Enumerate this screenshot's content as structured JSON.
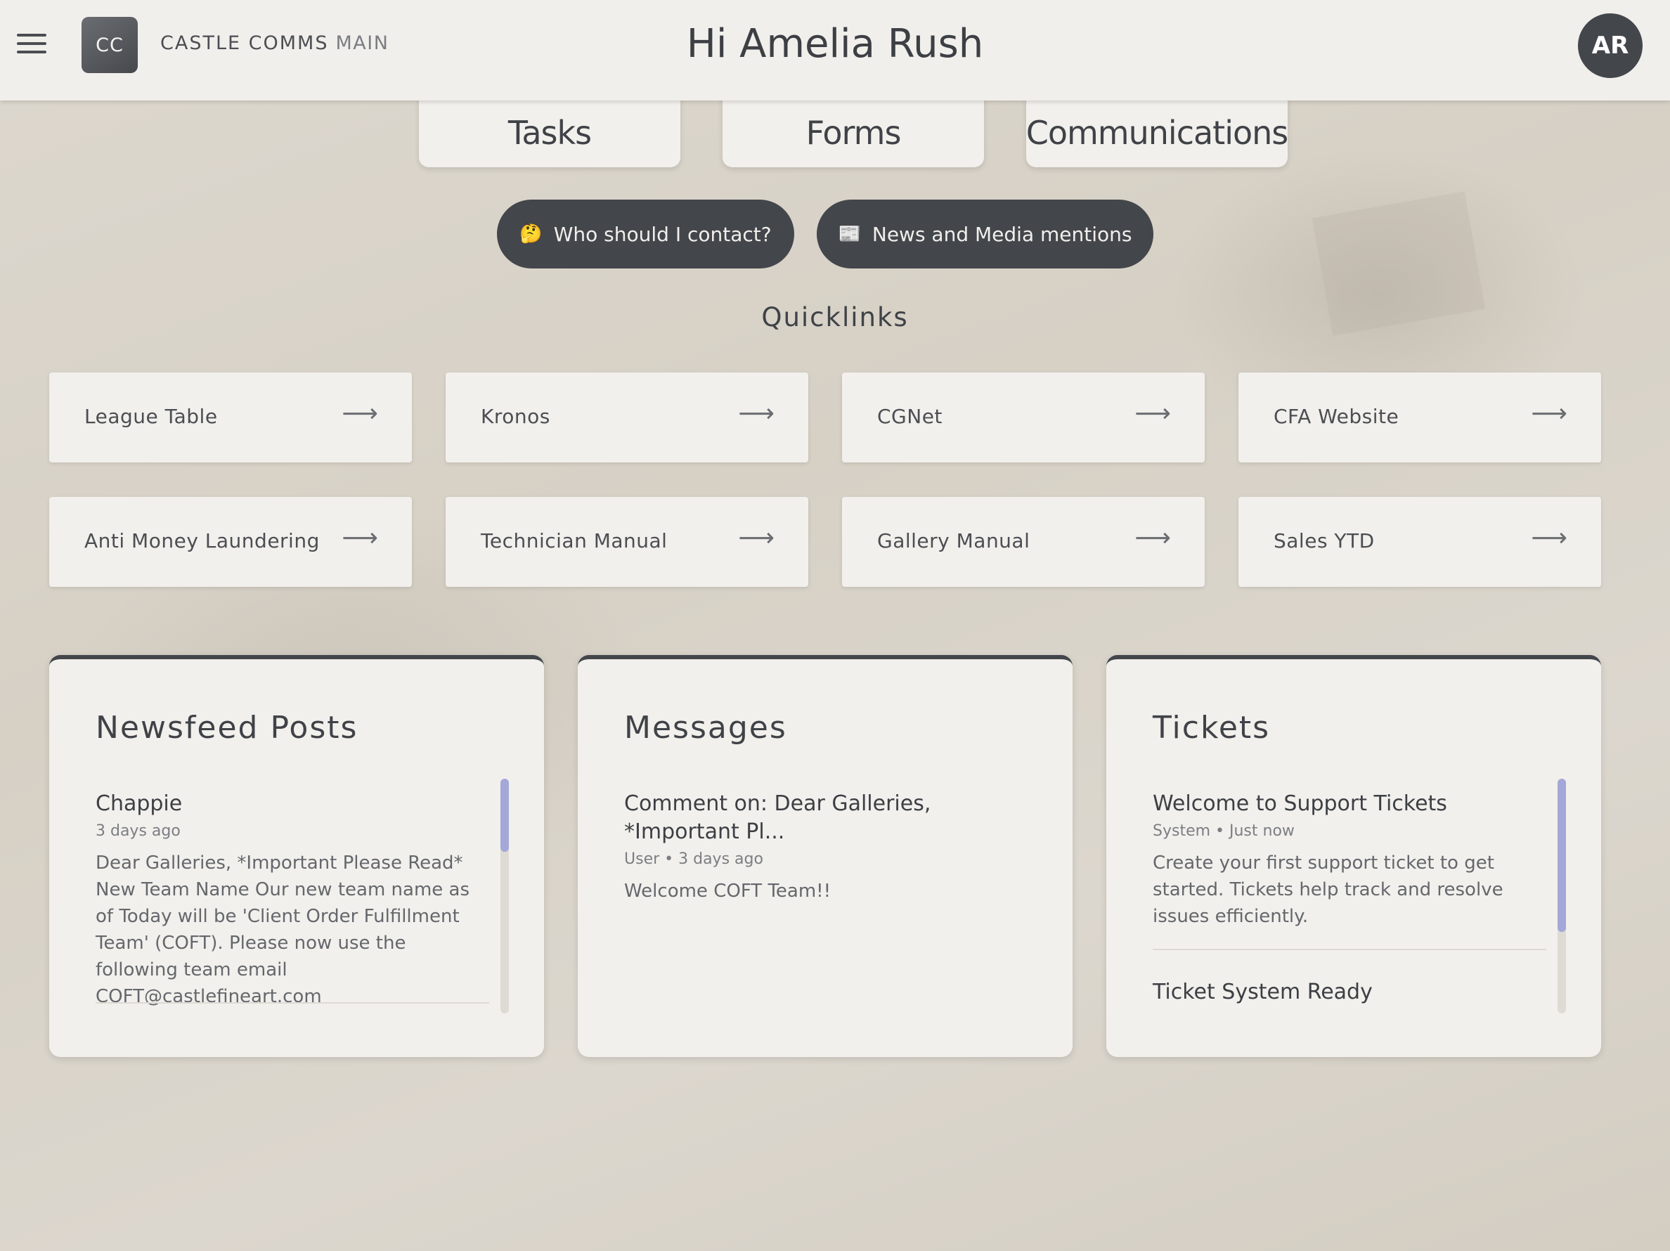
{
  "header": {
    "logo_initials": "CC",
    "brand": "CASTLE COMMS",
    "brand_sub": "MAIN",
    "greeting": "Hi Amelia Rush",
    "avatar_initials": "AR"
  },
  "tabs": [
    {
      "label": "Tasks"
    },
    {
      "label": "Forms"
    },
    {
      "label": "Communications"
    }
  ],
  "pills": [
    {
      "emoji": "🤔",
      "label": "Who should I contact?"
    },
    {
      "emoji": "📰",
      "label": "News and Media mentions"
    }
  ],
  "quicklinks": {
    "title": "Quicklinks",
    "arrow": "⟶",
    "items": [
      {
        "label": "League Table"
      },
      {
        "label": "Kronos"
      },
      {
        "label": "CGNet"
      },
      {
        "label": "CFA Website"
      },
      {
        "label": "Anti Money Laundering"
      },
      {
        "label": "Technician Manual"
      },
      {
        "label": "Gallery Manual"
      },
      {
        "label": "Sales YTD"
      }
    ]
  },
  "newsfeed": {
    "title": "Newsfeed Posts",
    "posts": [
      {
        "title": "Chappie",
        "meta": "3 days ago",
        "body": "Dear Galleries, *Important Please Read* New Team Name Our new team name as of Today will be 'Client Order Fulfillment Team' (COFT). Please now use the following team email COFT@castlefineart.com"
      }
    ]
  },
  "messages": {
    "title": "Messages",
    "items": [
      {
        "title": "Comment on: Dear Galleries, *Important Pl...",
        "meta": "User • 3 days ago",
        "body": "Welcome COFT Team!!"
      }
    ]
  },
  "tickets": {
    "title": "Tickets",
    "items": [
      {
        "title": "Welcome to Support Tickets",
        "meta": "System • Just now",
        "body": "Create your first support ticket to get started. Tickets help track and resolve issues efficiently."
      },
      {
        "title": "Ticket System Ready"
      }
    ]
  }
}
